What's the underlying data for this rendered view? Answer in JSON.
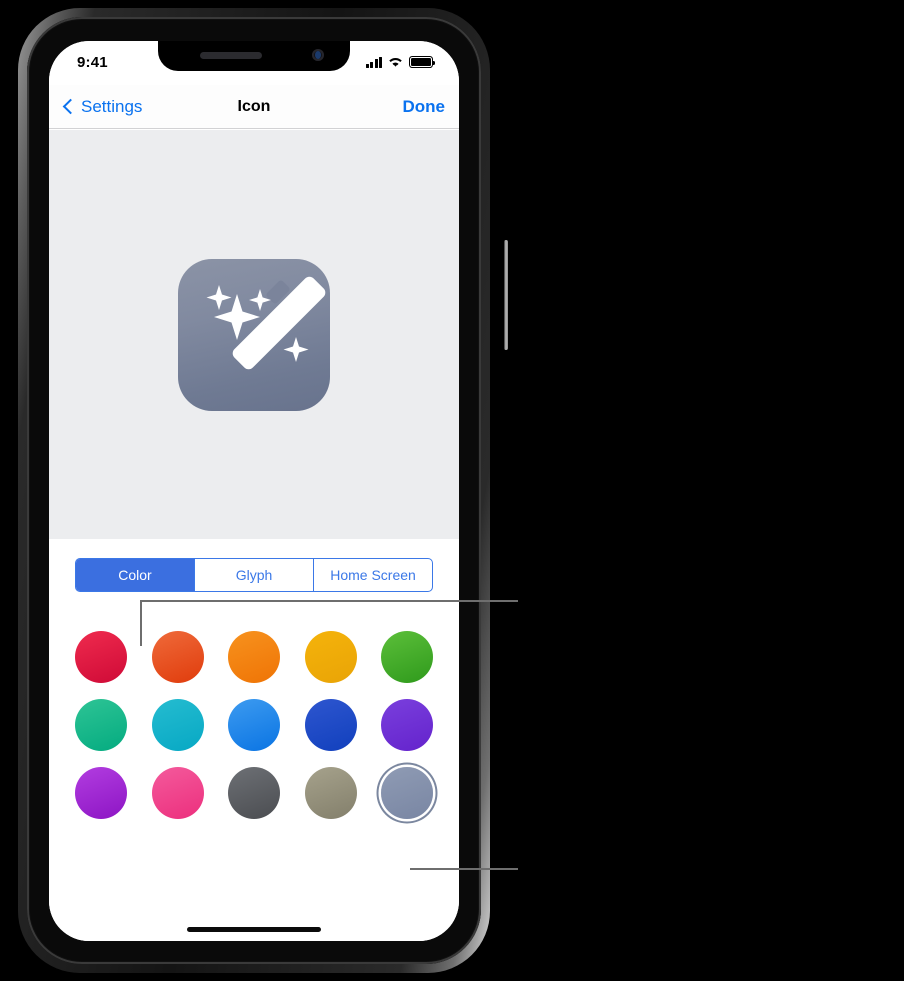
{
  "status_bar": {
    "time": "9:41",
    "cellular_icon": "signal-bars-icon",
    "wifi_icon": "wifi-icon",
    "battery_icon": "battery-icon"
  },
  "nav_bar": {
    "back_label": "Settings",
    "back_icon": "chevron-left-icon",
    "title": "Icon",
    "done_label": "Done"
  },
  "preview": {
    "icon_name": "magic-wand-app-icon",
    "icon_glyph": "magic-wand-sparkles",
    "icon_background_top": "#8b93a6",
    "icon_background_bottom": "#68738d"
  },
  "segmented_control": {
    "selected_index": 0,
    "accent_color": "#3b6fe0",
    "segments": [
      {
        "label": "Color"
      },
      {
        "label": "Glyph"
      },
      {
        "label": "Home Screen"
      }
    ]
  },
  "color_grid": {
    "selected_row": 2,
    "selected_col": 4,
    "rows": [
      [
        {
          "name": "red",
          "top": "#ef2b4e",
          "bottom": "#cf0a37"
        },
        {
          "name": "red-orange",
          "top": "#ef6a3a",
          "bottom": "#e03c0c"
        },
        {
          "name": "orange",
          "top": "#f7921e",
          "bottom": "#ef7405"
        },
        {
          "name": "amber",
          "top": "#f5b30b",
          "bottom": "#e9a406"
        },
        {
          "name": "green",
          "top": "#5cbf3a",
          "bottom": "#2f9a1c"
        }
      ],
      [
        {
          "name": "teal-green",
          "top": "#2ec495",
          "bottom": "#04ab80"
        },
        {
          "name": "cyan",
          "top": "#25bcd0",
          "bottom": "#07a8c4"
        },
        {
          "name": "light-blue",
          "top": "#3d9bf0",
          "bottom": "#0a74e3"
        },
        {
          "name": "blue",
          "top": "#2e56cf",
          "bottom": "#1140bd"
        },
        {
          "name": "violet",
          "top": "#7a3fdd",
          "bottom": "#6423cc"
        }
      ],
      [
        {
          "name": "magenta",
          "top": "#b23de0",
          "bottom": "#8d15c4"
        },
        {
          "name": "pink",
          "top": "#f45a9c",
          "bottom": "#ec2f7d"
        },
        {
          "name": "dark-gray",
          "top": "#6d7075",
          "bottom": "#4b4d51"
        },
        {
          "name": "taupe",
          "top": "#a6a28c",
          "bottom": "#837f6b"
        },
        {
          "name": "slate-blue",
          "top": "#8f9bb4",
          "bottom": "#7986a3"
        }
      ]
    ]
  },
  "home_indicator": {
    "name": "home-indicator"
  },
  "annotations": {
    "line_to_segmented_control": "callout-segmented-control",
    "line_to_selected_color": "callout-selected-color"
  }
}
